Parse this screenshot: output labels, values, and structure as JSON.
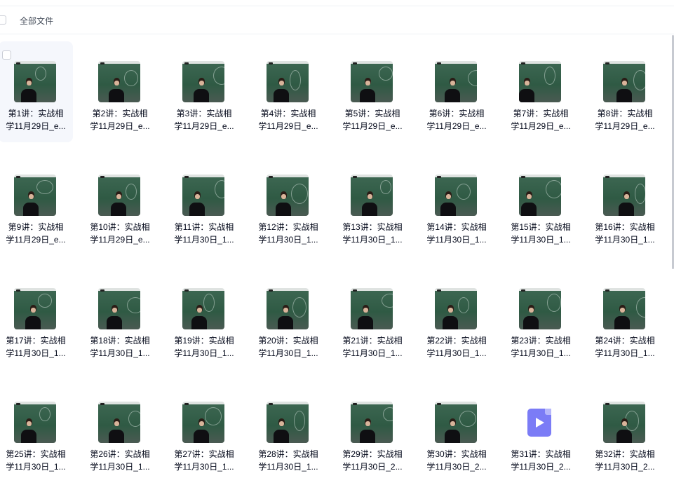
{
  "header": {
    "select_all_label": "全部文件"
  },
  "files": [
    {
      "line1": "第1讲：实战相",
      "line2": "学11月29日_e...",
      "type": "video",
      "selected": true
    },
    {
      "line1": "第2讲：实战相",
      "line2": "学11月29日_e...",
      "type": "video"
    },
    {
      "line1": "第3讲：实战相",
      "line2": "学11月29日_e...",
      "type": "video"
    },
    {
      "line1": "第4讲：实战相",
      "line2": "学11月29日_e...",
      "type": "video"
    },
    {
      "line1": "第5讲：实战相",
      "line2": "学11月29日_e...",
      "type": "video"
    },
    {
      "line1": "第6讲：实战相",
      "line2": "学11月29日_e...",
      "type": "video"
    },
    {
      "line1": "第7讲：实战相",
      "line2": "学11月29日_e...",
      "type": "video"
    },
    {
      "line1": "第8讲：实战相",
      "line2": "学11月29日_e...",
      "type": "video"
    },
    {
      "line1": "第9讲：实战相",
      "line2": "学11月29日_e...",
      "type": "video"
    },
    {
      "line1": "第10讲：实战相",
      "line2": "学11月29日_e...",
      "type": "video"
    },
    {
      "line1": "第11讲：实战相",
      "line2": "学11月30日_1...",
      "type": "video"
    },
    {
      "line1": "第12讲：实战相",
      "line2": "学11月30日_1...",
      "type": "video"
    },
    {
      "line1": "第13讲：实战相",
      "line2": "学11月30日_1...",
      "type": "video"
    },
    {
      "line1": "第14讲：实战相",
      "line2": "学11月30日_1...",
      "type": "video"
    },
    {
      "line1": "第15讲：实战相",
      "line2": "学11月30日_1...",
      "type": "video"
    },
    {
      "line1": "第16讲：实战相",
      "line2": "学11月30日_1...",
      "type": "video"
    },
    {
      "line1": "第17讲：实战相",
      "line2": "学11月30日_1...",
      "type": "video"
    },
    {
      "line1": "第18讲：实战相",
      "line2": "学11月30日_1...",
      "type": "video"
    },
    {
      "line1": "第19讲：实战相",
      "line2": "学11月30日_1...",
      "type": "video"
    },
    {
      "line1": "第20讲：实战相",
      "line2": "学11月30日_1...",
      "type": "video"
    },
    {
      "line1": "第21讲：实战相",
      "line2": "学11月30日_1...",
      "type": "video"
    },
    {
      "line1": "第22讲：实战相",
      "line2": "学11月30日_1...",
      "type": "video"
    },
    {
      "line1": "第23讲：实战相",
      "line2": "学11月30日_1...",
      "type": "video"
    },
    {
      "line1": "第24讲：实战相",
      "line2": "学11月30日_1...",
      "type": "video"
    },
    {
      "line1": "第25讲：实战相",
      "line2": "学11月30日_1...",
      "type": "video"
    },
    {
      "line1": "第26讲：实战相",
      "line2": "学11月30日_1...",
      "type": "video"
    },
    {
      "line1": "第27讲：实战相",
      "line2": "学11月30日_1...",
      "type": "video"
    },
    {
      "line1": "第28讲：实战相",
      "line2": "学11月30日_1...",
      "type": "video"
    },
    {
      "line1": "第29讲：实战相",
      "line2": "学11月30日_2...",
      "type": "video"
    },
    {
      "line1": "第30讲：实战相",
      "line2": "学11月30日_2...",
      "type": "video"
    },
    {
      "line1": "第31讲：实战相",
      "line2": "学11月30日_2...",
      "type": "file-icon"
    },
    {
      "line1": "第32讲：实战相",
      "line2": "学11月30日_2...",
      "type": "video"
    }
  ],
  "colors": {
    "accent": "#7b7cf6",
    "selected_bg": "#f5f7fc",
    "text": "#03081a"
  },
  "icons": {
    "video_thumbnail": "video-thumbnail",
    "file_type": "video-file-icon"
  }
}
